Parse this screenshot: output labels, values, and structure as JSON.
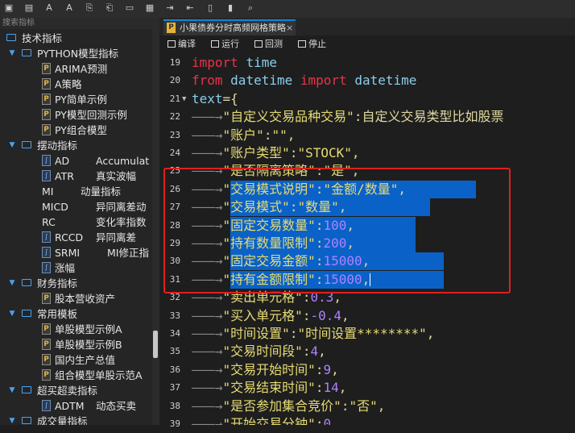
{
  "toolbar": {
    "icons": [
      "save-icon",
      "save-all-icon",
      "font-decrease-icon",
      "font-increase-icon",
      "undo-icon",
      "redo-icon",
      "copy-icon",
      "paste-icon",
      "indent-icon",
      "outdent-icon",
      "comment-icon",
      "uncomment-icon",
      "search-icon"
    ]
  },
  "left_panel": {
    "header": "搜索指标",
    "root": "技术指标",
    "groups": [
      {
        "label": "PYTHON模型指标",
        "items": [
          {
            "label": "ARIMA预测",
            "desc": ""
          },
          {
            "label": "A策略",
            "desc": ""
          },
          {
            "label": "PY简单示例",
            "desc": ""
          },
          {
            "label": "PY模型回测示例",
            "desc": ""
          },
          {
            "label": "PY组合模型",
            "desc": ""
          }
        ]
      },
      {
        "label": "摆动指标",
        "items": [
          {
            "label": "AD",
            "desc": "Accumulat"
          },
          {
            "label": "ATR",
            "desc": "真实波幅"
          },
          {
            "label": "MI",
            "desc": "动量指标"
          },
          {
            "label": "MICD",
            "desc": "异同离差动"
          },
          {
            "label": "RC",
            "desc": "变化率指数"
          },
          {
            "label": "RCCD",
            "desc": "异同离差"
          },
          {
            "label": "SRMI",
            "desc": "MI修正指"
          },
          {
            "label": "涨幅",
            "desc": ""
          }
        ]
      },
      {
        "label": "财务指标",
        "items": [
          {
            "label": "股本营收资产",
            "desc": ""
          }
        ]
      },
      {
        "label": "常用模板",
        "items": [
          {
            "label": "单股模型示例A",
            "desc": ""
          },
          {
            "label": "单股模型示例B",
            "desc": ""
          },
          {
            "label": "国内生产总值",
            "desc": ""
          },
          {
            "label": "组合模型单股示范A",
            "desc": ""
          }
        ]
      },
      {
        "label": "超买超卖指标",
        "items": [
          {
            "label": "ADTM",
            "desc": "动态买卖"
          }
        ]
      },
      {
        "label": "成交量指标",
        "items": []
      }
    ]
  },
  "editor": {
    "tab_title": "小果债券分时高频网格策略",
    "tab_close": "×",
    "actions": {
      "compile": "编译",
      "run": "运行",
      "backtest": "回测",
      "stop": "停止"
    },
    "lines": [
      {
        "n": "19",
        "text": "import time"
      },
      {
        "n": "20",
        "text": "from datetime import datetime"
      },
      {
        "n": "21",
        "text": "text={"
      },
      {
        "n": "22",
        "text": "\"自定义交易品种交易\":\"自定义交易类型比如股票"
      },
      {
        "n": "23",
        "text": "\"账户\":\"\","
      },
      {
        "n": "24",
        "text": "\"账户类型\":\"STOCK\","
      },
      {
        "n": "25",
        "text": "\"是否隔离策略\":\"是\","
      },
      {
        "n": "26",
        "text": "\"交易模式说明\":\"金额/数量\","
      },
      {
        "n": "27",
        "text": "\"交易模式\":\"数量\","
      },
      {
        "n": "28",
        "text": "\"固定交易数量\":100,"
      },
      {
        "n": "29",
        "text": "\"持有数量限制\":200,"
      },
      {
        "n": "30",
        "text": "\"固定交易金额\":15000,"
      },
      {
        "n": "31",
        "text": "\"持有金额限制\":15000,"
      },
      {
        "n": "32",
        "text": "\"卖出单元格\":0.3,"
      },
      {
        "n": "33",
        "text": "\"买入单元格\":-0.4,"
      },
      {
        "n": "34",
        "text": "\"时间设置\":\"时间设置********\","
      },
      {
        "n": "35",
        "text": "\"交易时间段\":4,"
      },
      {
        "n": "36",
        "text": "\"交易开始时间\":9,"
      },
      {
        "n": "37",
        "text": "\"交易结束时间\":14,"
      },
      {
        "n": "38",
        "text": "\"是否参加集合竞价\":\"否\","
      },
      {
        "n": "39",
        "text": "\"开始交易分钟\":0,"
      }
    ]
  }
}
